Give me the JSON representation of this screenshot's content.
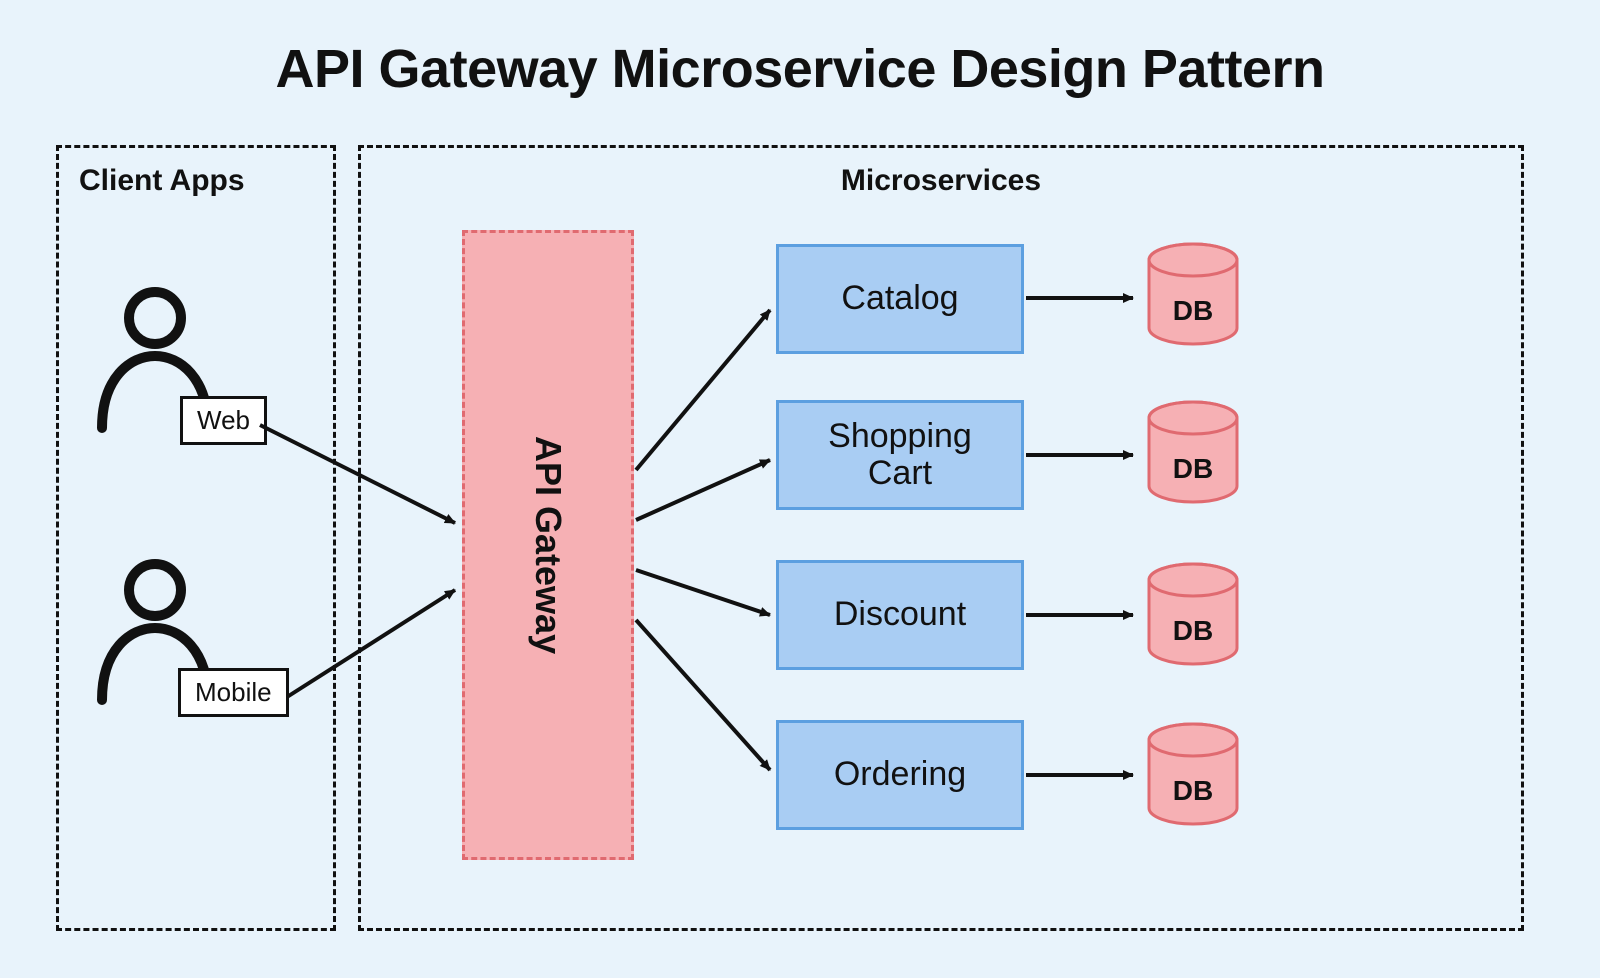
{
  "title": "API Gateway Microservice Design Pattern",
  "groups": {
    "client_apps": {
      "label": "Client Apps"
    },
    "microservices": {
      "label": "Microservices"
    }
  },
  "clients": {
    "web": {
      "label": "Web"
    },
    "mobile": {
      "label": "Mobile"
    }
  },
  "gateway": {
    "label": "API Gateway"
  },
  "services": [
    {
      "label": "Catalog",
      "db_label": "DB"
    },
    {
      "label": "Shopping\nCart",
      "db_label": "DB"
    },
    {
      "label": "Discount",
      "db_label": "DB"
    },
    {
      "label": "Ordering",
      "db_label": "DB"
    }
  ],
  "colors": {
    "bg": "#e8f3fb",
    "gateway_fill": "#f6b0b4",
    "gateway_border": "#e06a70",
    "service_fill": "#a9cdf3",
    "service_border": "#5c9fe0",
    "db_fill": "#f6b0b4",
    "db_border": "#e06a70",
    "line": "#111111"
  }
}
